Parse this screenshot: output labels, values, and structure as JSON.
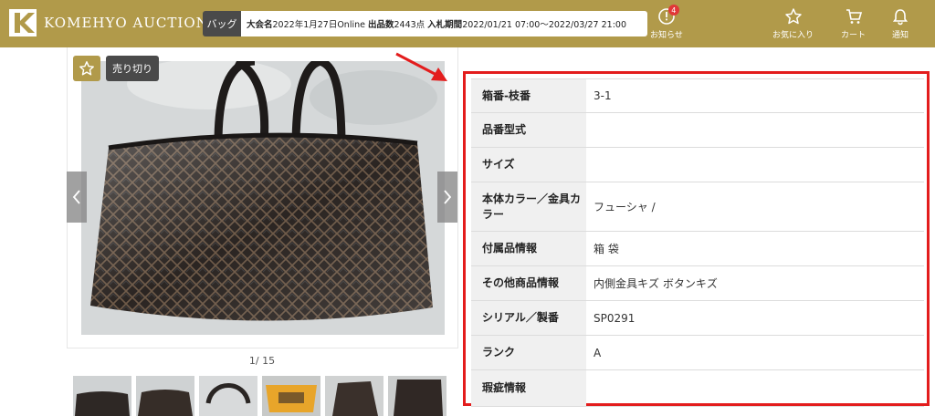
{
  "header": {
    "logo_text": "KOMEHYO AUCTION",
    "category": "バッグ",
    "sale_name_label": "大会名",
    "sale_name": "2022年1月27日Online",
    "count_label": "出品数",
    "count": "2443点",
    "period_label": "入札期間",
    "period": "2022/01/21 07:00〜2022/03/27 21:00",
    "notice": {
      "label": "お知らせ",
      "badge": "4"
    },
    "favorites": "お気に入り",
    "cart": "カート",
    "notify": "通知"
  },
  "gallery": {
    "sold_label": "売り切り",
    "counter": "1/ 15",
    "thumb_count": 6
  },
  "specs": [
    {
      "label": "箱番-枝番",
      "value": "3-1"
    },
    {
      "label": "品番型式",
      "value": ""
    },
    {
      "label": "サイズ",
      "value": ""
    },
    {
      "label": "本体カラー／金具カラー",
      "value": "フューシャ /"
    },
    {
      "label": "付属品情報",
      "value": "箱 袋"
    },
    {
      "label": "その他商品情報",
      "value": "内側金具キズ ボタンキズ"
    },
    {
      "label": "シリアル／製番",
      "value": "SP0291"
    },
    {
      "label": "ランク",
      "value": "A"
    },
    {
      "label": "瑕疵情報",
      "value": ""
    }
  ],
  "colors": {
    "brand_gold": "#b19a4a",
    "dark": "#4a4a4a",
    "highlight_red": "#e31d1d",
    "badge_red": "#e13838"
  }
}
